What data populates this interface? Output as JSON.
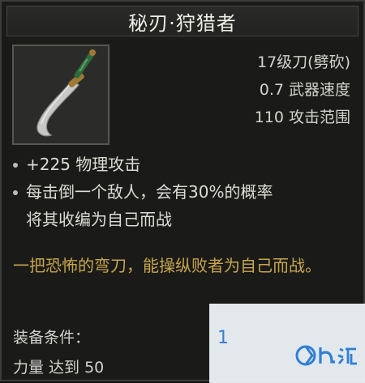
{
  "item": {
    "name": "秘刃·狩猎者",
    "icon": "curved-blade-icon",
    "stats": [
      "17级刀(劈砍)",
      "0.7 武器速度",
      "110 攻击范围"
    ],
    "affixes": [
      "+225 物理攻击",
      "每击倒一个敌人，会有30%的概率\n将其收编为自己而战"
    ],
    "flavor_text": "一把恐怖的弯刀，能操纵败者为自己而战。",
    "requirements": {
      "header": "装备条件：",
      "value": "力量 达到 50"
    }
  },
  "watermark": {
    "fragment": "1"
  },
  "colors": {
    "background": "#1a1b19",
    "flavor": "#c8a54b",
    "text": "#d3d2cb"
  }
}
